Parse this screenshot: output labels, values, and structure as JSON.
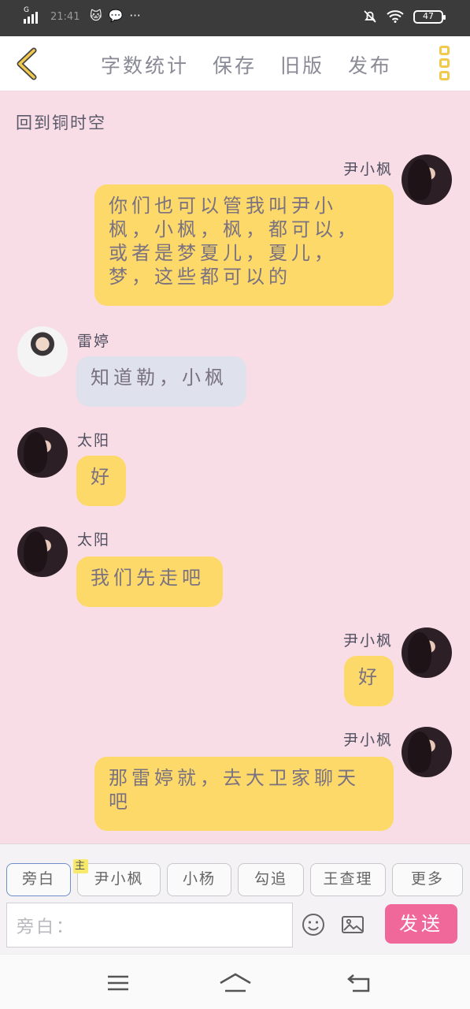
{
  "status_bar": {
    "network": "G",
    "time": "21:41",
    "battery": "47"
  },
  "top_nav": {
    "items": [
      "字数统计",
      "保存",
      "旧版",
      "发布"
    ]
  },
  "chat": {
    "back_link": "回到铜时空",
    "messages": [
      {
        "side": "right",
        "sender": "尹小枫",
        "text": "你们也可以管我叫尹小枫，小枫，枫，都可以，或者是梦夏儿，夏儿，梦，这些都可以的",
        "bubble": "yellow"
      },
      {
        "side": "left",
        "sender": "雷婷",
        "text": "知道勒，小枫",
        "bubble": "blue"
      },
      {
        "side": "left",
        "sender": "太阳",
        "text": "好",
        "bubble": "yellow"
      },
      {
        "side": "left",
        "sender": "太阳",
        "text": "我们先走吧",
        "bubble": "yellow"
      },
      {
        "side": "right",
        "sender": "尹小枫",
        "text": "好",
        "bubble": "yellow"
      },
      {
        "side": "right",
        "sender": "尹小枫",
        "text": "那雷婷就，去大卫家聊天吧",
        "bubble": "yellow"
      }
    ]
  },
  "panel": {
    "chips": [
      "旁白",
      "尹小枫",
      "小杨",
      "勾追",
      "王查理",
      "更多"
    ],
    "main_tag": "主",
    "input_placeholder": "旁白：",
    "send_label": "发送"
  },
  "colors": {
    "accent_yellow": "#fdd96a",
    "send_pink": "#f0679a",
    "background_pink": "#f9dde6"
  }
}
